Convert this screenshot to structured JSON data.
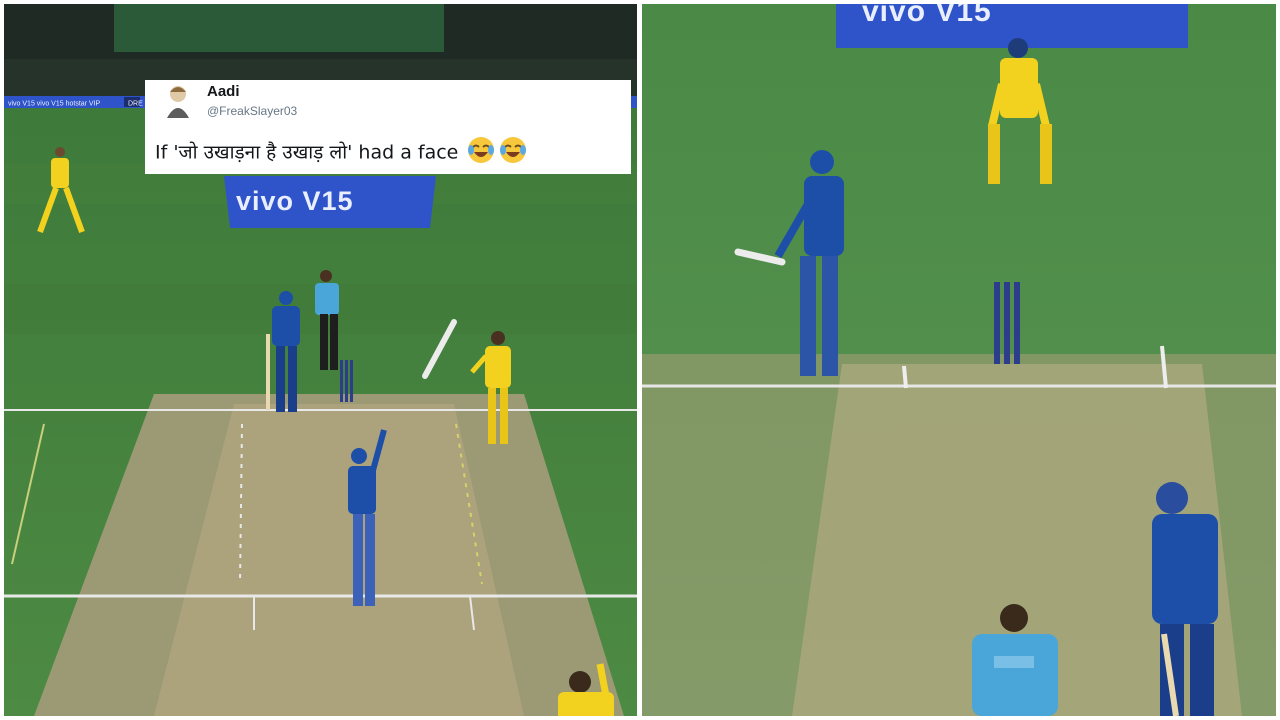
{
  "tweet": {
    "name": "Aadi",
    "handle": "@FreakSlayer03",
    "text": "If 'जो उखाड़ना है उखाड़ लो' had a face",
    "emojis": [
      "face-with-tears-of-joy",
      "face-with-tears-of-joy"
    ]
  },
  "left_panel": {
    "sponsor_board": "vivo V15",
    "perimeter_board": "vivo V15  vivo V15  hotstar VIP",
    "ad_fragment": "DRE"
  },
  "right_panel": {
    "sponsor_board": "vivo V15"
  },
  "colors": {
    "grass": "#4f8a45",
    "pitch": "#a9a07a",
    "mi_blue": "#1d4fa8",
    "csk_yellow": "#f2d21e",
    "umpire_blue": "#4aa6d8",
    "board_blue": "#2f54c9"
  }
}
